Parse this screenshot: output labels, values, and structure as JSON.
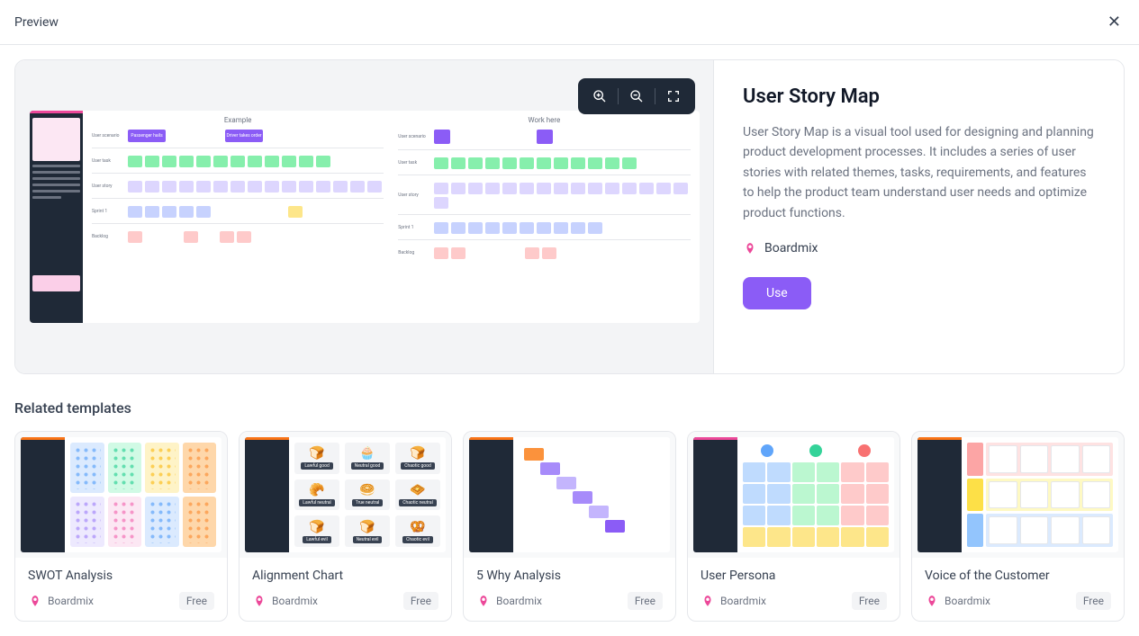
{
  "topbar": {
    "title": "Preview"
  },
  "template": {
    "title": "User Story Map",
    "description": "User Story Map is a visual tool used for designing and planning product development processes. It includes a series of user stories with related themes, tasks, requirements, and features to help the product team understand user needs and optimize product functions.",
    "author": "Boardmix",
    "use_label": "Use"
  },
  "preview": {
    "col1_title": "Example",
    "col2_title": "Work here",
    "rows": {
      "scenario": "User scenario",
      "task": "User task",
      "story": "User story",
      "sprint": "Sprint 1",
      "backlog": "Backlog"
    },
    "scenario_labels": {
      "a": "Passenger hails",
      "b": "Driver takes order"
    }
  },
  "related": {
    "heading": "Related templates",
    "cards": [
      {
        "name": "SWOT Analysis",
        "author": "Boardmix",
        "badge": "Free"
      },
      {
        "name": "Alignment Chart",
        "author": "Boardmix",
        "badge": "Free"
      },
      {
        "name": "5 Why Analysis",
        "author": "Boardmix",
        "badge": "Free"
      },
      {
        "name": "User Persona",
        "author": "Boardmix",
        "badge": "Free"
      },
      {
        "name": "Voice of the Customer",
        "author": "Boardmix",
        "badge": "Free"
      }
    ]
  }
}
